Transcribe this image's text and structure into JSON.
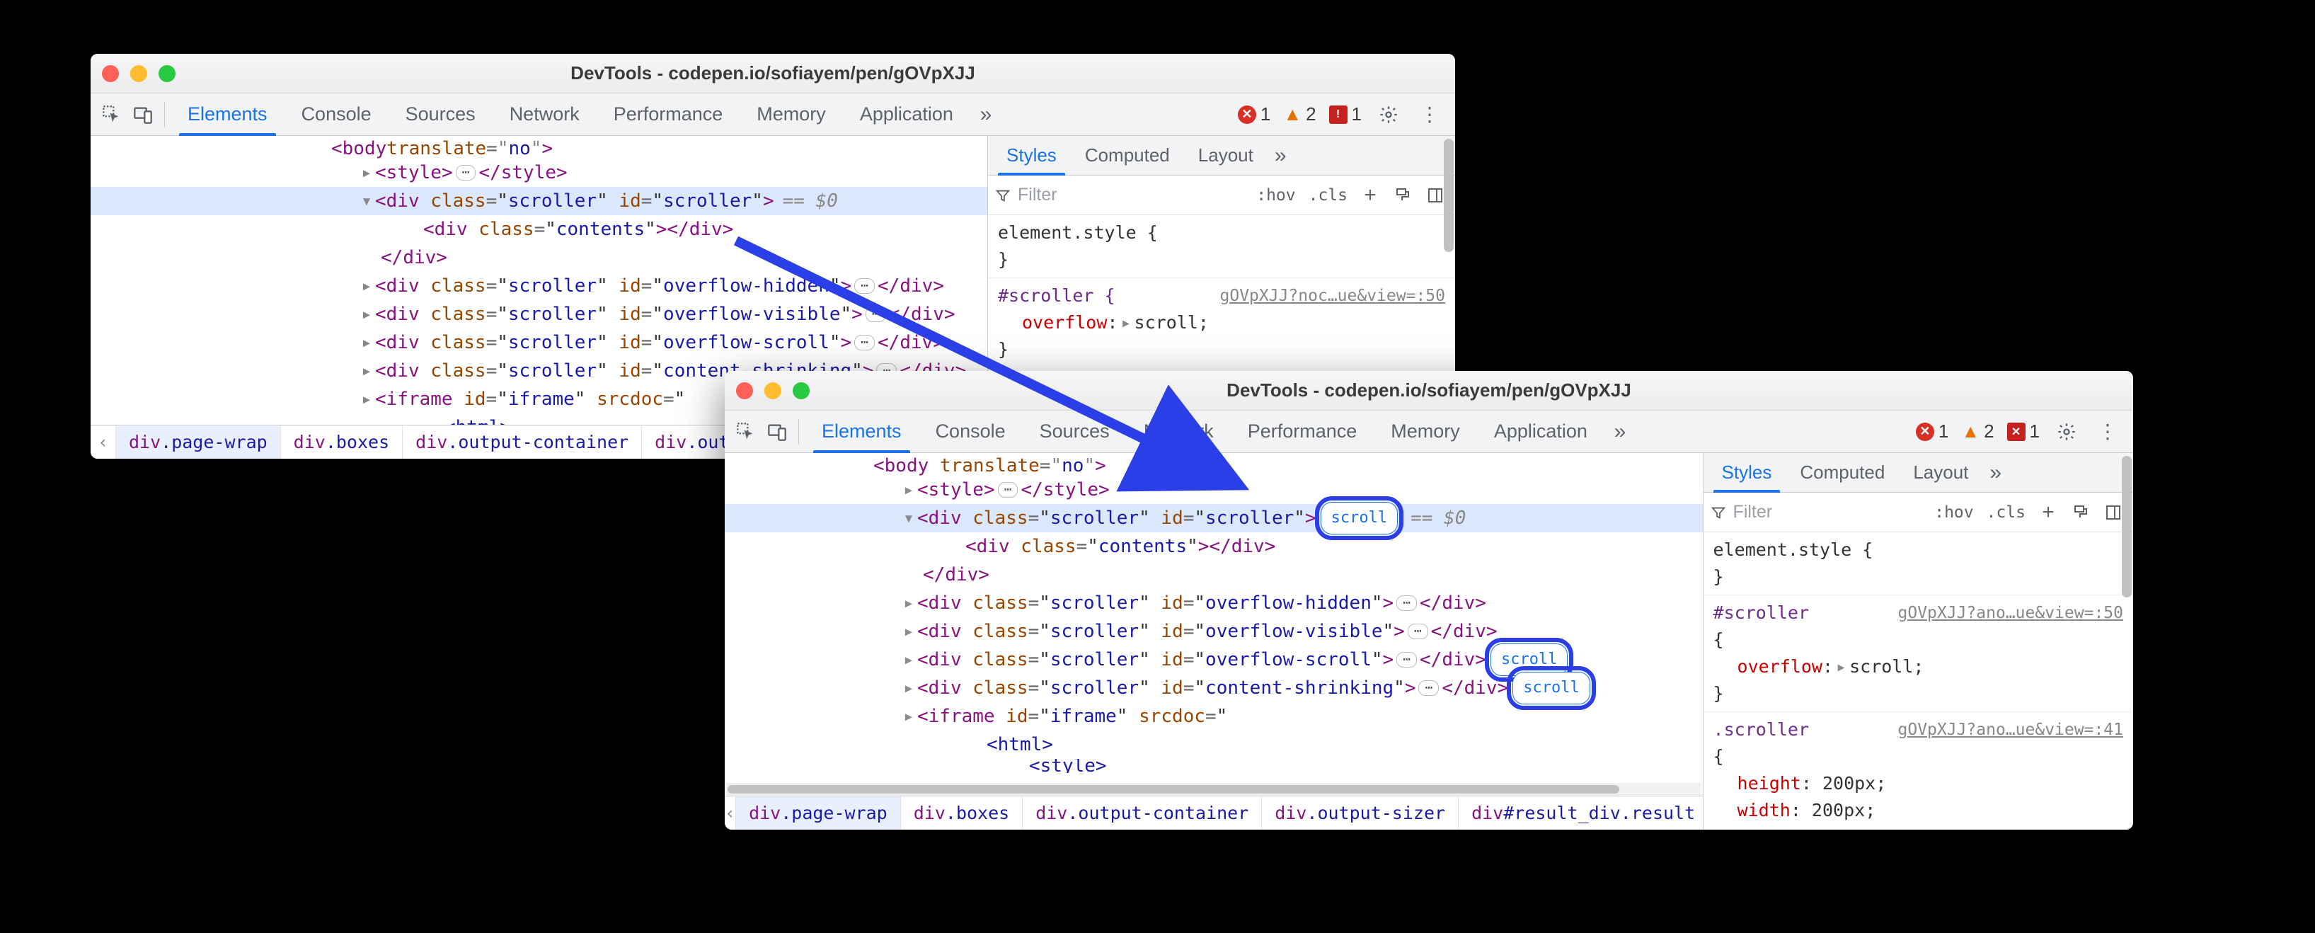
{
  "windows": {
    "a": {
      "title": "DevTools - codepen.io/sofiayem/pen/gOVpXJJ"
    },
    "b": {
      "title": "DevTools - codepen.io/sofiayem/pen/gOVpXJJ"
    }
  },
  "toolbar_tabs": {
    "elements": "Elements",
    "console": "Console",
    "sources": "Sources",
    "network": "Network",
    "performance": "Performance",
    "memory": "Memory",
    "application": "Application"
  },
  "counts": {
    "errors": "1",
    "warnings": "2",
    "issues": "1"
  },
  "side_tabs": {
    "styles": "Styles",
    "computed": "Computed",
    "layout": "Layout"
  },
  "filter": {
    "placeholder": "Filter",
    "hov": ":hov",
    "cls": ".cls"
  },
  "styles_a": {
    "element_open": "element.style {",
    "element_close": "}",
    "rule1_sel": "#scroller {",
    "rule1_src": "gOVpXJJ?noc…ue&view=:50",
    "rule1_prop_name": "overflow",
    "rule1_prop_val": "scroll",
    "rule1_close": "}"
  },
  "styles_b": {
    "element_open": "element.style {",
    "element_close": "}",
    "rule1_sel": "#scroller",
    "rule1_src": "gOVpXJJ?ano…ue&view=:50",
    "rule1_open": "{",
    "rule1_prop_name": "overflow",
    "rule1_prop_val": "scroll",
    "rule1_close": "}",
    "rule2_sel": ".scroller",
    "rule2_src": "gOVpXJJ?ano…ue&view=:41",
    "rule2_open": "{",
    "rule2_p1_name": "height",
    "rule2_p1_val": "200px",
    "rule2_p2_name": "width",
    "rule2_p2_val": "200px"
  },
  "dom": {
    "body_line_a": "<body translate=\"no\">",
    "style_open": "<style>",
    "style_close": "</style>",
    "scroller_open_pre": "<div class=\"scroller\" id=\"scroller\">",
    "contents": "<div class=\"contents\"></div>",
    "div_close": "</div>",
    "overflow_hidden": "<div class=\"scroller\" id=\"overflow-hidden\">",
    "overflow_visible": "<div class=\"scroller\" id=\"overflow-visible\">",
    "overflow_scroll": "<div class=\"scroller\" id=\"overflow-scroll\">",
    "content_shrinking": "<div class=\"scroller\" id=\"content-shrinking\">",
    "iframe": "<iframe id=\"iframe\" srcdoc=\"",
    "html_inner": "<html>",
    "style_inner": "<style>",
    "eq0": "== $0",
    "scroll_badge": "scroll"
  },
  "breadcrumbs": {
    "items": [
      "div.page-wrap",
      "div.boxes",
      "div.output-container",
      "div.output-sizer",
      "div#result_div.result"
    ]
  }
}
